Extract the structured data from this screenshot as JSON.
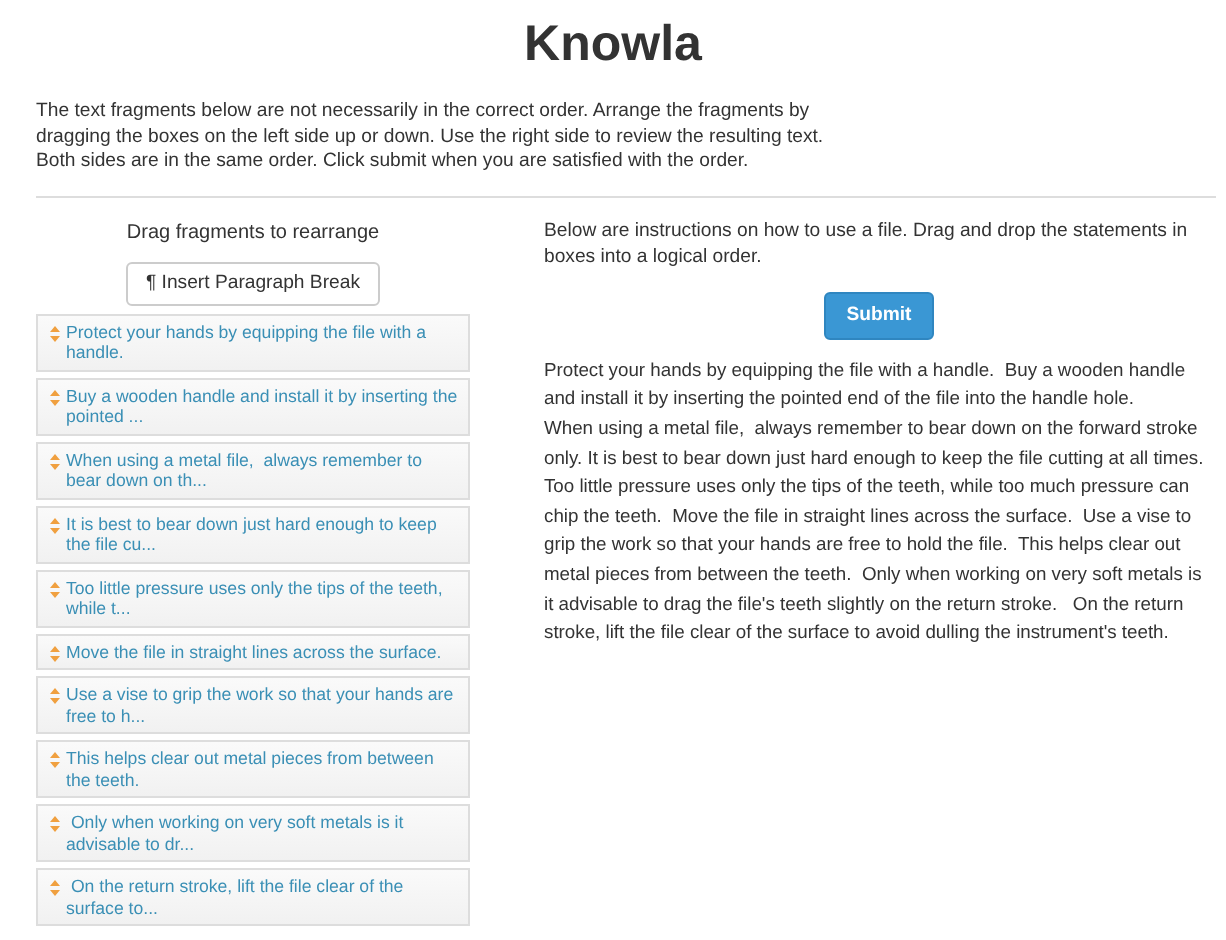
{
  "title": "Knowla",
  "intro": [
    "The text fragments below are not necessarily in the correct order. Arrange the fragments by",
    "dragging the boxes on the left side up or down. Use the right side to review the resulting text.",
    "Both sides are in the same order. Click submit when you are satisfied with the order."
  ],
  "left": {
    "heading": "Drag fragments to rearrange",
    "break_button": "¶ Insert Paragraph Break",
    "fragments": [
      {
        "text": "Protect your hands by equipping the file with a handle."
      },
      {
        "text": "Buy a wooden handle and install it by inserting the pointed ..."
      },
      {
        "text": "When using a metal file,  always remember to bear down on th..."
      },
      {
        "text": "It is best to bear down just hard enough to keep the file cu..."
      },
      {
        "text": "Too little pressure uses only the tips of the teeth, while t..."
      },
      {
        "text": "Move the file in straight lines across the surface."
      },
      {
        "text": "Use a vise to grip the work so that your hands are free to h..."
      },
      {
        "text": "This helps clear out metal pieces from between the teeth."
      },
      {
        "text": " Only when working on very soft metals is it advisable to dr..."
      },
      {
        "text": " On the return stroke, lift the file clear of the surface to..."
      }
    ]
  },
  "right": {
    "instructions": "Below are instructions on how to use a file. Drag and drop the statements in boxes into a logical order.",
    "submit": "Submit",
    "preview": [
      "Protect your hands by equipping the file with a handle.  Buy a wooden handle and install it by inserting the pointed end of the file into the handle hole.",
      "When using a metal file,  always remember to bear down on the forward stroke only. It is best to bear down just hard enough to keep the file cutting at all times.  Too little pressure uses only the tips of the teeth, while too much pressure can chip the teeth.  Move the file in straight lines across the surface.  Use a vise to grip the work so that your hands are free to hold the file.  This helps clear out metal pieces from between the teeth.  Only when working on very soft metals is it advisable to drag the file's teeth slightly on the return stroke.   On the return stroke, lift the file clear of the surface to avoid dulling the instrument's teeth."
    ]
  }
}
